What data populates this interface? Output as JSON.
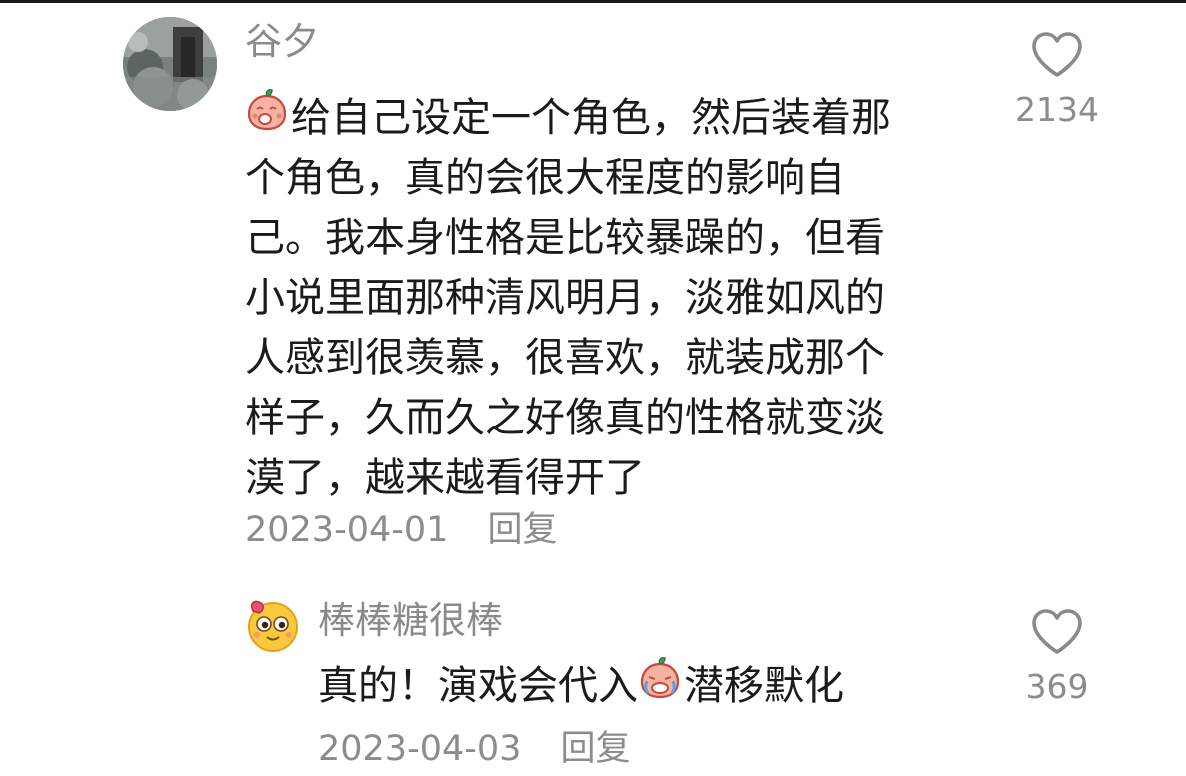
{
  "main_comment": {
    "username": "谷夕",
    "emoji_icon": "peach-face-emoji-icon",
    "text_lines": [
      "给自己设定一个角色，然后装着那",
      "个角色，真的会很大程度的影响自",
      "己。我本身性格是比较暴躁的，但看",
      "小说里面那种清风明月，淡雅如风的",
      "人感到很羡慕，很喜欢，就装成那个",
      "样子，久而久之好像真的性格就变淡",
      "漠了，越来越看得开了"
    ],
    "date": "2023-04-01",
    "reply_label": "回复",
    "like_icon": "heart-outline-icon",
    "like_count": "2134"
  },
  "reply_comment": {
    "username": "棒棒糖很棒",
    "text_before_emoji": "真的！演戏会代入",
    "emoji_icon": "crying-peach-emoji-icon",
    "text_after_emoji": "潜移默化",
    "date": "2023-04-03",
    "reply_label": "回复",
    "like_icon": "heart-outline-icon",
    "like_count": "369"
  },
  "colors": {
    "text_primary": "#1b1b1b",
    "text_secondary": "#8c8c8c",
    "background": "#ffffff"
  }
}
